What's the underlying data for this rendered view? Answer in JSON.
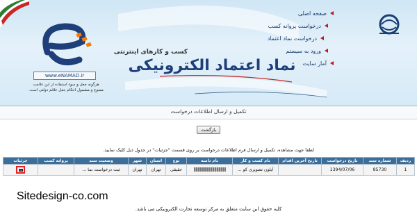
{
  "header": {
    "site_title": "نماد اعتماد الکترونیکی",
    "subtitle": "کسب و کارهای اینترنتی",
    "logo_url_text": "www.eNAMAD.ir",
    "disclaimer": "هرگونه جعل و سوء استفاده از این علامت ممنوع و مشمول احکام جعل علائم دولتی است.",
    "nav": [
      {
        "label": "صفحه اصلی"
      },
      {
        "label": "درخواست پروانه کسب"
      },
      {
        "label": "درخواست نماد اعتماد"
      },
      {
        "label": "ورود به سیستم"
      },
      {
        "label": "آمار سایت"
      }
    ],
    "colors": {
      "navy": "#1f3f7a",
      "accent_red": "#b71c1c",
      "sky": "#cfe6f5"
    }
  },
  "section": {
    "title": "تکمیل و ارسال اطلاعات درخواست",
    "back_label": "بازگشت",
    "instruction": "لطفا جهت مشاهده، تکمیل و ارسال فرم اطلاعات درخواست بر روی قسمت \"جزئیات\" در جدول ذیل کلیک نمایید."
  },
  "table": {
    "columns": [
      "ردیف",
      "شماره سند",
      "تاریخ درخواست",
      "تاریخ آخرین اقدام",
      "نام کسب و کار",
      "نام دامنه",
      "نوع",
      "استان",
      "شهر",
      "وضعیت سند",
      "پروانه کسب",
      "جزئیات"
    ],
    "rows": [
      {
        "row": "1",
        "doc_number": "85730",
        "request_date": "1394/07/06",
        "last_action_date": "",
        "business_name": "آیلون تصویری کو ...",
        "domain": "",
        "type": "حقیقی",
        "province": "تهران",
        "city": "تهران",
        "status": "ثبت درخواست نما ...",
        "license": "",
        "details_icon": "details-icon"
      }
    ]
  },
  "watermark": "Sitedesign-co.com",
  "footer": "کلیه حقوق این سایت متعلق به مرکز توسعه تجارت الکترونیکی می باشد."
}
